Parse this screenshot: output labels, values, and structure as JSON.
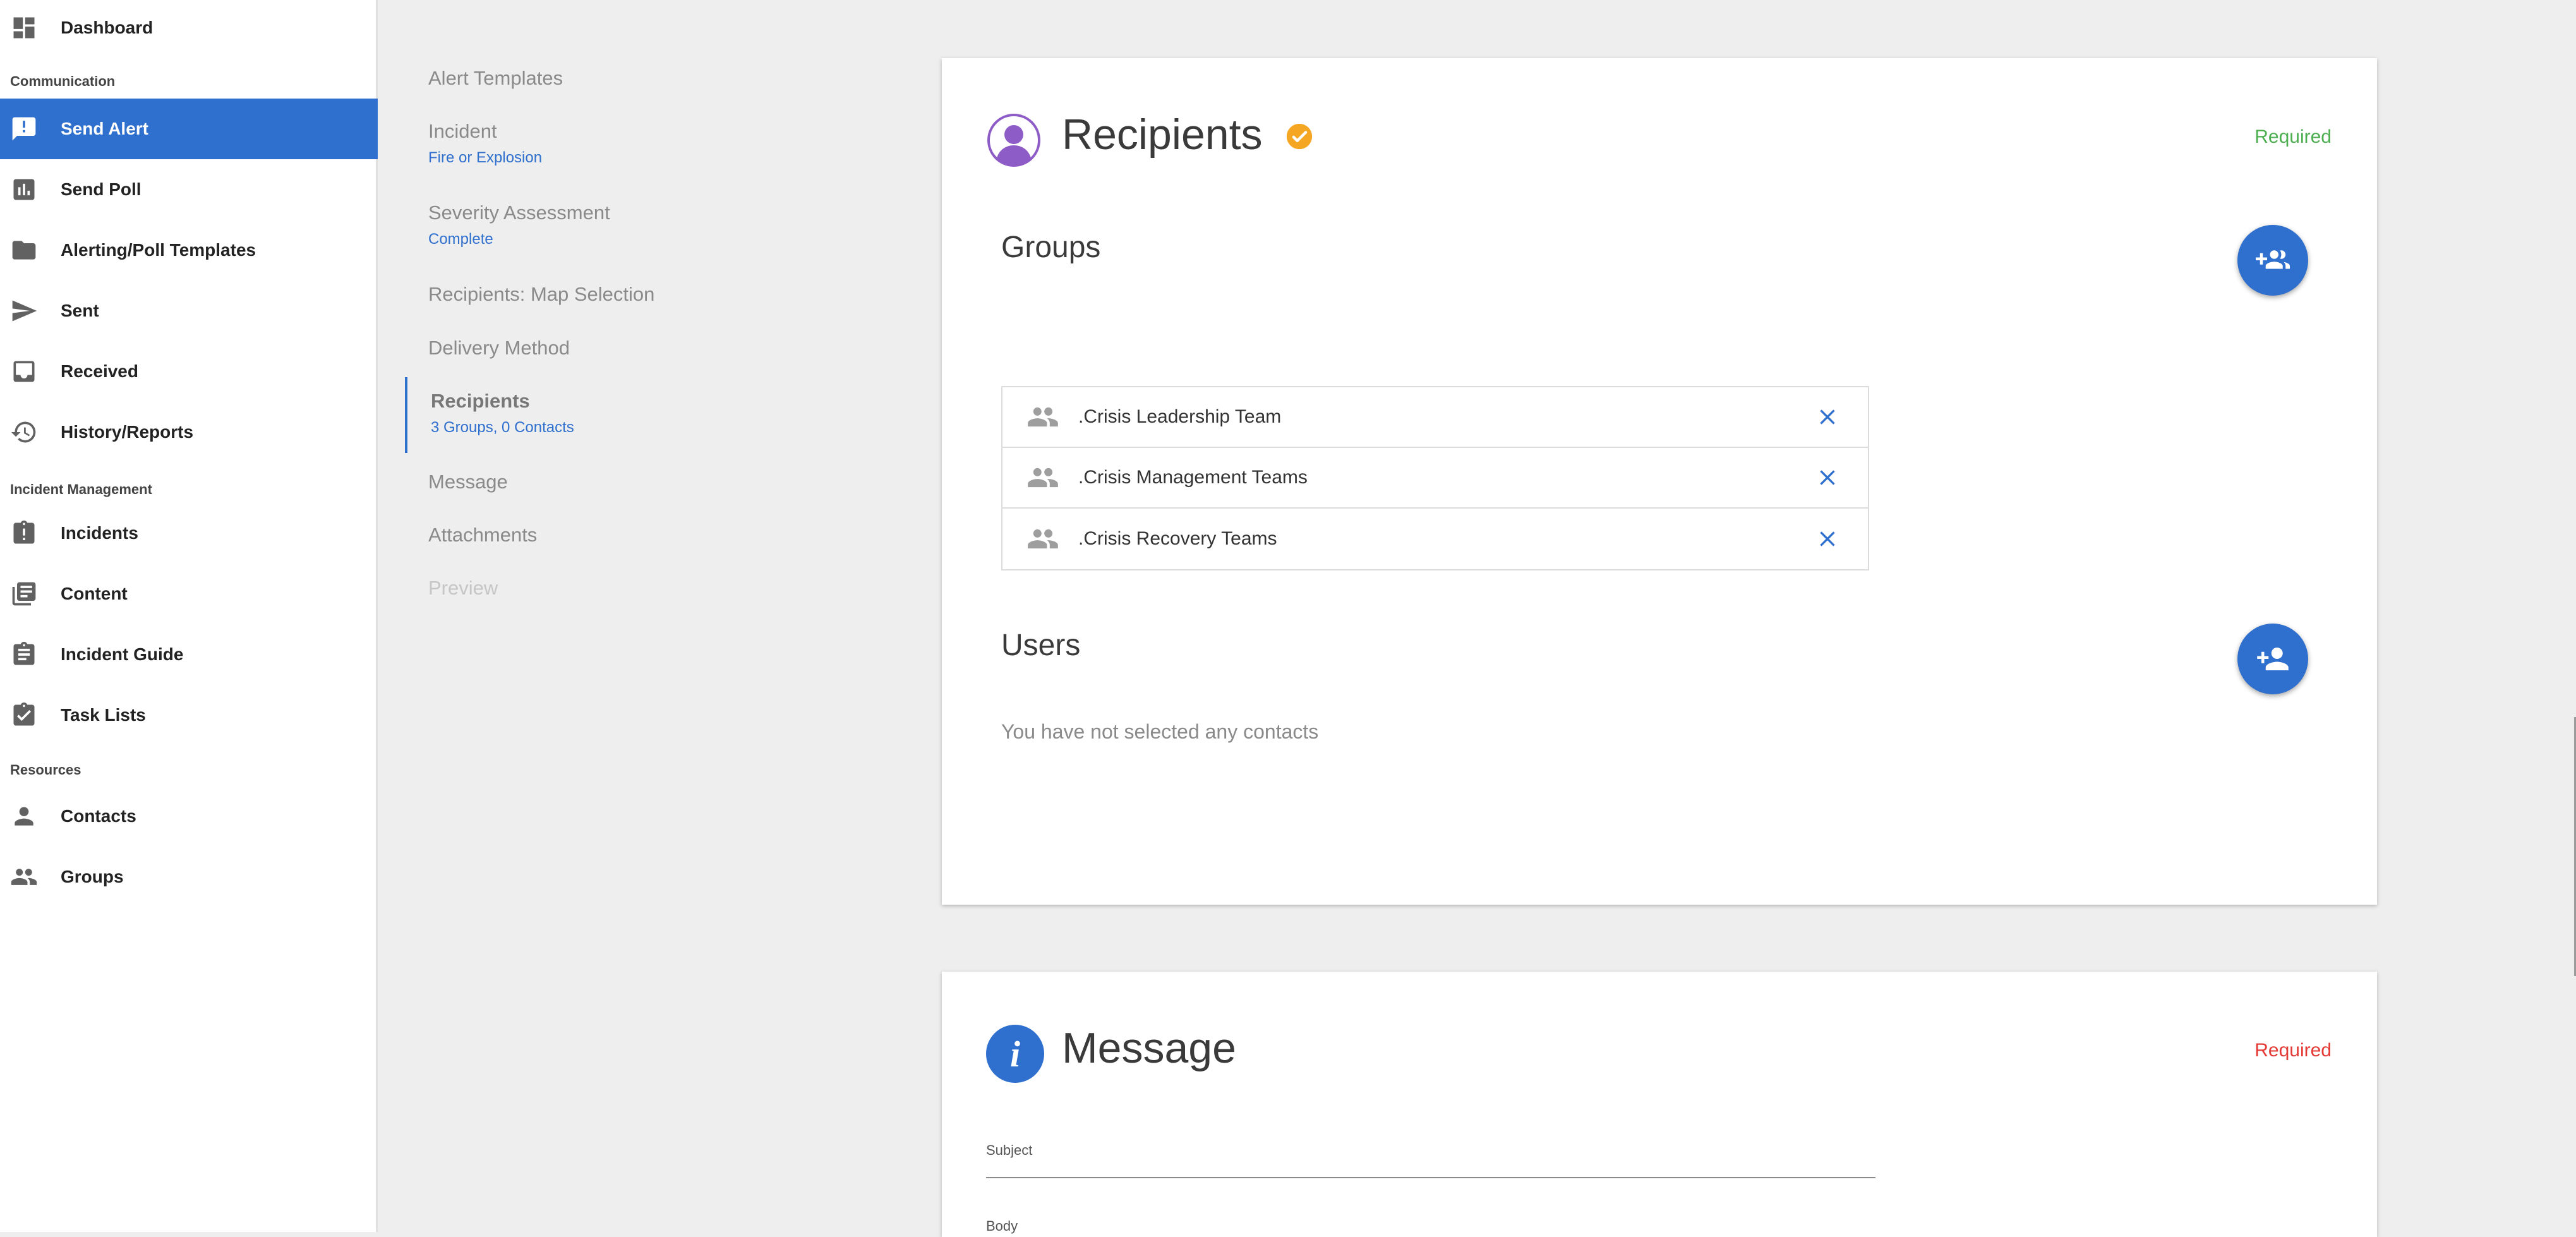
{
  "sidebar": {
    "items": [
      {
        "label": "Dashboard",
        "icon": "dashboard-icon"
      },
      {
        "label": "Send Alert",
        "icon": "alert-message-icon",
        "active": true
      },
      {
        "label": "Send Poll",
        "icon": "poll-chart-icon"
      },
      {
        "label": "Alerting/Poll Templates",
        "icon": "folder-icon"
      },
      {
        "label": "Sent",
        "icon": "send-icon"
      },
      {
        "label": "Received",
        "icon": "inbox-icon"
      },
      {
        "label": "History/Reports",
        "icon": "history-icon"
      },
      {
        "label": "Incidents",
        "icon": "clipboard-alert-icon"
      },
      {
        "label": "Content",
        "icon": "library-books-icon"
      },
      {
        "label": "Incident Guide",
        "icon": "assignment-icon"
      },
      {
        "label": "Task Lists",
        "icon": "assignment-check-icon"
      },
      {
        "label": "Contacts",
        "icon": "person-icon"
      },
      {
        "label": "Groups",
        "icon": "people-icon"
      }
    ],
    "sections": [
      "Communication",
      "Incident Management",
      "Resources"
    ]
  },
  "steps": [
    {
      "title": "Alert Templates",
      "subtitle": ""
    },
    {
      "title": "Incident",
      "subtitle": "Fire or Explosion"
    },
    {
      "title": "Severity Assessment",
      "subtitle": "Complete"
    },
    {
      "title": "Recipients: Map Selection",
      "subtitle": ""
    },
    {
      "title": "Delivery Method",
      "subtitle": ""
    },
    {
      "title": "Recipients",
      "subtitle": "3 Groups, 0 Contacts",
      "active": true
    },
    {
      "title": "Message",
      "subtitle": ""
    },
    {
      "title": "Attachments",
      "subtitle": ""
    },
    {
      "title": "Preview",
      "subtitle": "",
      "disabled": true
    }
  ],
  "recipients": {
    "title": "Recipients",
    "required_label": "Required",
    "required_color": "#4caf50",
    "complete_color": "#f5a623",
    "avatar_color": "#8e5cc6",
    "groups_heading": "Groups",
    "groups": [
      {
        "name": ".Crisis Leadership Team"
      },
      {
        "name": ".Crisis Management Teams"
      },
      {
        "name": ".Crisis Recovery Teams"
      }
    ],
    "users_heading": "Users",
    "users_empty": "You have not selected any contacts"
  },
  "message": {
    "title": "Message",
    "required_label": "Required",
    "required_color": "#e53935",
    "subject_label": "Subject",
    "body_label": "Body"
  },
  "colors": {
    "accent": "#2f6fce",
    "background": "#eeeeee"
  }
}
